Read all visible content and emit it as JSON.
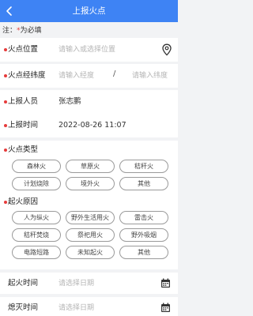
{
  "header": {
    "title": "上报火点"
  },
  "note": {
    "prefix": "注：",
    "star": "*",
    "suffix": "为必填"
  },
  "fields": {
    "location": {
      "label": "火点位置",
      "placeholder": "请输入或选择位置"
    },
    "coords": {
      "label": "火点经纬度",
      "lng_placeholder": "请输入经度",
      "separator": "/",
      "lat_placeholder": "请输入纬度"
    },
    "reporter": {
      "label": "上报人员",
      "value": "张志鹏"
    },
    "report_time": {
      "label": "上报时间",
      "value": "2022-08-26 11:07"
    },
    "ignition_time": {
      "label": "起火时间",
      "placeholder": "请选择日期"
    },
    "extinguish_time": {
      "label": "熄灭时间",
      "placeholder": "请选择日期"
    }
  },
  "fire_type": {
    "title": "火点类型",
    "options": [
      "森林火",
      "草原火",
      "秸秆火",
      "计划烧除",
      "境外火",
      "其他"
    ]
  },
  "fire_cause": {
    "title": "起火原因",
    "options": [
      "人为纵火",
      "野外生活用火",
      "雷击火",
      "秸秆焚烧",
      "祭祀用火",
      "野外吸烟",
      "电路短路",
      "未知起火",
      "其他"
    ]
  },
  "icons": {
    "back": "chevron-left-icon",
    "location": "location-pin-icon",
    "calendar": "calendar-icon"
  },
  "colors": {
    "header": "#3e83f4",
    "required": "#e63b3b"
  }
}
